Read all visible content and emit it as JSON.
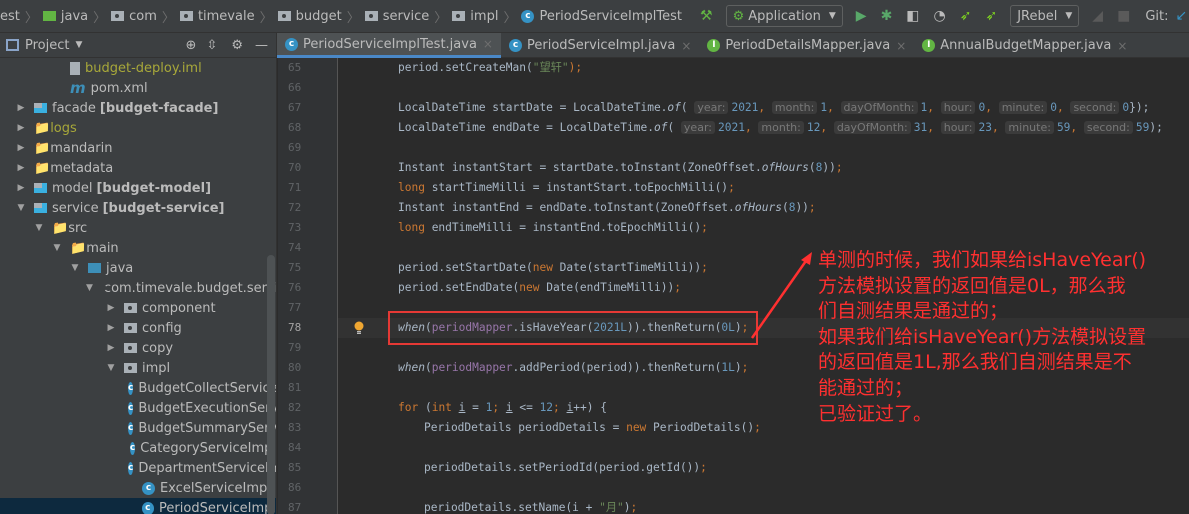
{
  "breadcrumb": [
    {
      "label": "est",
      "icon": "none"
    },
    {
      "label": "java",
      "icon": "folder-green-icon"
    },
    {
      "label": "com",
      "icon": "package-icon"
    },
    {
      "label": "timevale",
      "icon": "package-icon"
    },
    {
      "label": "budget",
      "icon": "package-icon"
    },
    {
      "label": "service",
      "icon": "package-icon"
    },
    {
      "label": "impl",
      "icon": "package-icon"
    },
    {
      "label": "PeriodServiceImplTest",
      "icon": "test-class-icon"
    }
  ],
  "toolbar": {
    "run_config": "Application",
    "jrebel": "JRebel",
    "git_label": "Git:"
  },
  "project_panel": {
    "title": "Project"
  },
  "tabs": [
    {
      "label": "PeriodServiceImplTest.java",
      "icon": "test-class-icon",
      "active": true
    },
    {
      "label": "PeriodServiceImpl.java",
      "icon": "class-icon",
      "active": false
    },
    {
      "label": "PeriodDetailsMapper.java",
      "icon": "interface-icon",
      "active": false
    },
    {
      "label": "AnnualBudgetMapper.java",
      "icon": "interface-icon",
      "active": false
    }
  ],
  "tree": [
    {
      "depth": 2,
      "label": "budget-deploy.iml",
      "icon": "file-icon",
      "arrow": "",
      "style": "olive"
    },
    {
      "depth": 2,
      "label": "pom.xml",
      "icon": "maven-icon",
      "arrow": ""
    },
    {
      "depth": 0,
      "label": "facade",
      "module": "[budget-facade]",
      "icon": "module-folder-icon",
      "arrow": "right"
    },
    {
      "depth": 0,
      "label": "logs",
      "icon": "folder-icon",
      "arrow": "right",
      "style": "olive"
    },
    {
      "depth": 0,
      "label": "mandarin",
      "icon": "folder-icon",
      "arrow": "right"
    },
    {
      "depth": 0,
      "label": "metadata",
      "icon": "folder-icon",
      "arrow": "right"
    },
    {
      "depth": 0,
      "label": "model",
      "module": "[budget-model]",
      "icon": "module-folder-icon",
      "arrow": "right"
    },
    {
      "depth": 0,
      "label": "service",
      "module": "[budget-service]",
      "icon": "module-folder-icon",
      "arrow": "down"
    },
    {
      "depth": 1,
      "label": "src",
      "icon": "folder-icon",
      "arrow": "down"
    },
    {
      "depth": 2,
      "label": "main",
      "icon": "folder-icon",
      "arrow": "down"
    },
    {
      "depth": 3,
      "label": "java",
      "icon": "source-folder-icon",
      "arrow": "down"
    },
    {
      "depth": 4,
      "label": "com.timevale.budget.service",
      "icon": "package-icon",
      "arrow": "down"
    },
    {
      "depth": 5,
      "label": "component",
      "icon": "package-icon",
      "arrow": "right"
    },
    {
      "depth": 5,
      "label": "config",
      "icon": "package-icon",
      "arrow": "right"
    },
    {
      "depth": 5,
      "label": "copy",
      "icon": "package-icon",
      "arrow": "right"
    },
    {
      "depth": 5,
      "label": "impl",
      "icon": "package-icon",
      "arrow": "down"
    },
    {
      "depth": 6,
      "label": "BudgetCollectServiceImpl",
      "icon": "class-icon",
      "arrow": ""
    },
    {
      "depth": 6,
      "label": "BudgetExecutionServiceImpl",
      "icon": "class-icon",
      "arrow": ""
    },
    {
      "depth": 6,
      "label": "BudgetSummaryServiceImpl",
      "icon": "class-icon",
      "arrow": ""
    },
    {
      "depth": 6,
      "label": "CategoryServiceImpl",
      "icon": "class-icon",
      "arrow": ""
    },
    {
      "depth": 6,
      "label": "DepartmentServiceImpl",
      "icon": "class-icon",
      "arrow": ""
    },
    {
      "depth": 6,
      "label": "ExcelServiceImpl",
      "icon": "class-icon",
      "arrow": ""
    },
    {
      "depth": 6,
      "label": "PeriodServiceImpl",
      "icon": "class-icon",
      "arrow": "",
      "selected": true
    }
  ],
  "editor": {
    "current_line": 78,
    "highlighted_line": 78,
    "lines": [
      {
        "n": 65,
        "indent": 0,
        "t": [
          [
            "",
            "period.setCreateMan("
          ],
          [
            "str",
            "\"望轩\""
          ],
          [
            "kw",
            ");"
          ]
        ]
      },
      {
        "n": 66,
        "indent": 0,
        "t": []
      },
      {
        "n": 67,
        "indent": 0,
        "t": [
          [
            "",
            "LocalDateTime startDate = LocalDateTime."
          ],
          [
            "it",
            "of"
          ],
          [
            "",
            "( "
          ],
          [
            "hint",
            "year:"
          ],
          [
            "num",
            "2021"
          ],
          [
            "kw",
            ", "
          ],
          [
            "hint",
            "month:"
          ],
          [
            "num",
            "1"
          ],
          [
            "kw",
            ", "
          ],
          [
            "hint",
            "dayOfMonth:"
          ],
          [
            "num",
            "1"
          ],
          [
            "kw",
            ", "
          ],
          [
            "hint",
            "hour:"
          ],
          [
            "num",
            "0"
          ],
          [
            "kw",
            ", "
          ],
          [
            "hint",
            "minute:"
          ],
          [
            "num",
            "0"
          ],
          [
            "kw",
            ", "
          ],
          [
            "hint",
            "second:"
          ],
          [
            "num",
            "0"
          ],
          [
            "",
            "});"
          ]
        ]
      },
      {
        "n": 68,
        "indent": 0,
        "t": [
          [
            "",
            "LocalDateTime endDate = LocalDateTime."
          ],
          [
            "it",
            "of"
          ],
          [
            "",
            "( "
          ],
          [
            "hint",
            "year:"
          ],
          [
            "num",
            "2021"
          ],
          [
            "kw",
            ", "
          ],
          [
            "hint",
            "month:"
          ],
          [
            "num",
            "12"
          ],
          [
            "kw",
            ", "
          ],
          [
            "hint",
            "dayOfMonth:"
          ],
          [
            "num",
            "31"
          ],
          [
            "kw",
            ", "
          ],
          [
            "hint",
            "hour:"
          ],
          [
            "num",
            "23"
          ],
          [
            "kw",
            ", "
          ],
          [
            "hint",
            "minute:"
          ],
          [
            "num",
            "59"
          ],
          [
            "kw",
            ", "
          ],
          [
            "hint",
            "second:"
          ],
          [
            "num",
            "59"
          ],
          [
            "",
            ");"
          ]
        ]
      },
      {
        "n": 69,
        "indent": 0,
        "t": []
      },
      {
        "n": 70,
        "indent": 0,
        "t": [
          [
            "",
            "Instant instantStart = startDate.toInstant(ZoneOffset."
          ],
          [
            "it",
            "ofHours"
          ],
          [
            "",
            "("
          ],
          [
            "num",
            "8"
          ],
          [
            "",
            "))"
          ],
          [
            "kw",
            ";"
          ]
        ]
      },
      {
        "n": 71,
        "indent": 0,
        "t": [
          [
            "kw",
            "long "
          ],
          [
            "",
            "startTimeMilli = instantStart.toEpochMilli()"
          ],
          [
            "kw",
            ";"
          ]
        ]
      },
      {
        "n": 72,
        "indent": 0,
        "t": [
          [
            "",
            "Instant instantEnd = endDate.toInstant(ZoneOffset."
          ],
          [
            "it",
            "ofHours"
          ],
          [
            "",
            "("
          ],
          [
            "num",
            "8"
          ],
          [
            "",
            "))"
          ],
          [
            "kw",
            ";"
          ]
        ]
      },
      {
        "n": 73,
        "indent": 0,
        "t": [
          [
            "kw",
            "long "
          ],
          [
            "",
            "endTimeMilli = instantEnd.toEpochMilli()"
          ],
          [
            "kw",
            ";"
          ]
        ]
      },
      {
        "n": 74,
        "indent": 0,
        "t": []
      },
      {
        "n": 75,
        "indent": 0,
        "t": [
          [
            "",
            "period.setStartDate("
          ],
          [
            "kw",
            "new "
          ],
          [
            "",
            "Date(startTimeMilli))"
          ],
          [
            "kw",
            ";"
          ]
        ]
      },
      {
        "n": 76,
        "indent": 0,
        "t": [
          [
            "",
            "period.setEndDate("
          ],
          [
            "kw",
            "new "
          ],
          [
            "",
            "Date(endTimeMilli))"
          ],
          [
            "kw",
            ";"
          ]
        ]
      },
      {
        "n": 77,
        "indent": 0,
        "t": []
      },
      {
        "n": 78,
        "indent": 0,
        "t": [
          [
            "it",
            "when"
          ],
          [
            "",
            "("
          ],
          [
            "fld",
            "periodMapper"
          ],
          [
            "",
            ".isHaveYear("
          ],
          [
            "num",
            "2021L"
          ],
          [
            "",
            "))."
          ],
          [
            "",
            "thenReturn("
          ],
          [
            "num",
            "0L"
          ],
          [
            "",
            ")"
          ],
          [
            "kw",
            ";"
          ]
        ]
      },
      {
        "n": 79,
        "indent": 0,
        "t": []
      },
      {
        "n": 80,
        "indent": 0,
        "t": [
          [
            "it",
            "when"
          ],
          [
            "",
            "("
          ],
          [
            "fld",
            "periodMapper"
          ],
          [
            "",
            ".addPeriod(period)).thenReturn("
          ],
          [
            "num",
            "1L"
          ],
          [
            "",
            ")"
          ],
          [
            "kw",
            ";"
          ]
        ]
      },
      {
        "n": 81,
        "indent": 0,
        "t": []
      },
      {
        "n": 82,
        "indent": 0,
        "t": [
          [
            "kw",
            "for "
          ],
          [
            "",
            "("
          ],
          [
            "kw",
            "int "
          ],
          [
            "ul",
            "i"
          ],
          [
            "",
            " = "
          ],
          [
            "num",
            "1"
          ],
          [
            "kw",
            "; "
          ],
          [
            "ul",
            "i"
          ],
          [
            "",
            " <= "
          ],
          [
            "num",
            "12"
          ],
          [
            "kw",
            "; "
          ],
          [
            "ul",
            "i"
          ],
          [
            "",
            "++) {"
          ]
        ]
      },
      {
        "n": 83,
        "indent": 1,
        "t": [
          [
            "",
            "PeriodDetails periodDetails = "
          ],
          [
            "kw",
            "new "
          ],
          [
            "",
            "PeriodDetails()"
          ],
          [
            "kw",
            ";"
          ]
        ]
      },
      {
        "n": 84,
        "indent": 1,
        "t": []
      },
      {
        "n": 85,
        "indent": 1,
        "t": [
          [
            "",
            "periodDetails.setPeriodId(period.getId())"
          ],
          [
            "kw",
            ";"
          ]
        ]
      },
      {
        "n": 86,
        "indent": 1,
        "t": []
      },
      {
        "n": 87,
        "indent": 1,
        "t": [
          [
            "",
            "periodDetails.setName(i + "
          ],
          [
            "str",
            "\"月\""
          ],
          [
            "",
            ")"
          ],
          [
            "kw",
            ";"
          ]
        ]
      }
    ]
  },
  "annotation": {
    "color": "#ff3030",
    "lines": [
      "单测的时候，我们如果给isHaveYear()",
      "方法模拟设置的返回值是0L，那么我",
      "们自测结果是通过的；",
      "如果我们给isHaveYear()方法模拟设置",
      "的返回值是1L,那么我们自测结果是不",
      "能通过的；",
      "已验证过了。"
    ]
  }
}
